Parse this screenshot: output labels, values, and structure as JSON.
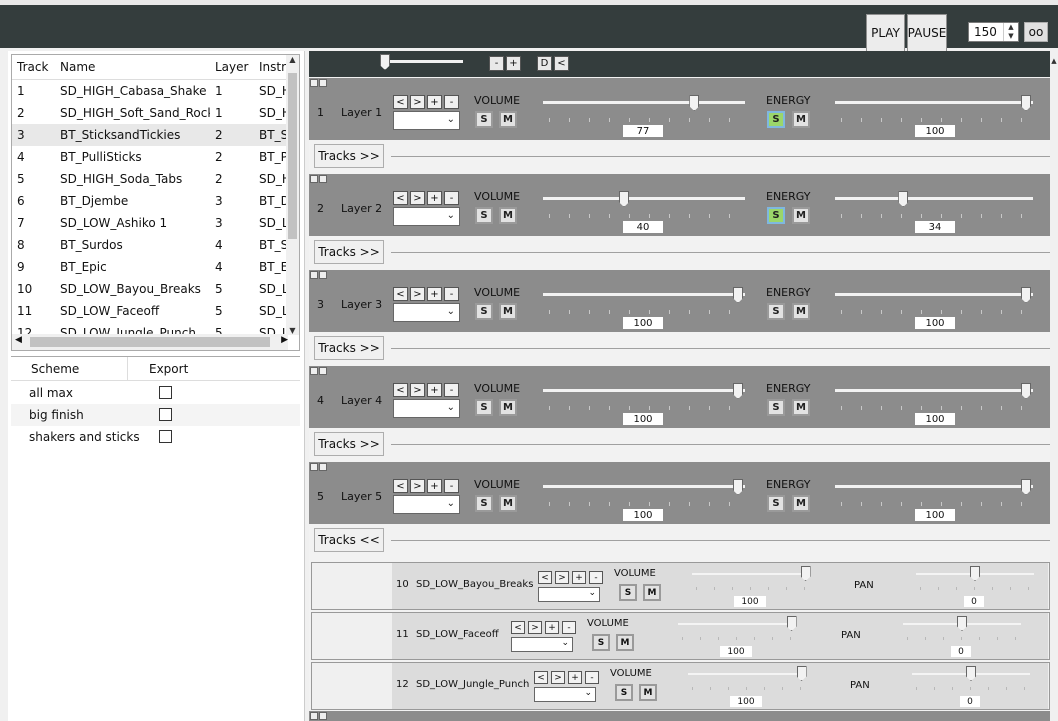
{
  "toolbar": {
    "play_label": "PLAY",
    "pause_label": "PAUSE",
    "tempo_value": "150",
    "oo_label": "oo"
  },
  "tracks": {
    "headers": [
      "Track",
      "Name",
      "Layer",
      "Instru"
    ],
    "rows": [
      {
        "track": "1",
        "name": "SD_HIGH_Cabasa_Shake",
        "layer": "1",
        "instr": "SD_HI"
      },
      {
        "track": "2",
        "name": "SD_HIGH_Soft_Sand_Rocks",
        "layer": "1",
        "instr": "SD_HI"
      },
      {
        "track": "3",
        "name": "BT_SticksandTickies",
        "layer": "2",
        "instr": "BT_St"
      },
      {
        "track": "4",
        "name": "BT_PulliSticks",
        "layer": "2",
        "instr": "BT_Pu"
      },
      {
        "track": "5",
        "name": "SD_HIGH_Soda_Tabs",
        "layer": "2",
        "instr": "SD_HI"
      },
      {
        "track": "6",
        "name": "BT_Djembe",
        "layer": "3",
        "instr": "BT_Dj"
      },
      {
        "track": "7",
        "name": "SD_LOW_Ashiko 1",
        "layer": "3",
        "instr": "SD_LC"
      },
      {
        "track": "8",
        "name": "BT_Surdos",
        "layer": "4",
        "instr": "BT_Su"
      },
      {
        "track": "9",
        "name": "BT_Epic",
        "layer": "4",
        "instr": "BT_Ep"
      },
      {
        "track": "10",
        "name": "SD_LOW_Bayou_Breaks",
        "layer": "5",
        "instr": "SD_LC"
      },
      {
        "track": "11",
        "name": "SD_LOW_Faceoff",
        "layer": "5",
        "instr": "SD_LC"
      },
      {
        "track": "12",
        "name": "SD_LOW_Jungle_Punch",
        "layer": "5",
        "instr": "SD_LC"
      }
    ]
  },
  "schemes": {
    "headers": [
      "Scheme",
      "Export"
    ],
    "rows": [
      {
        "name": "all max",
        "checked": false
      },
      {
        "name": "big finish",
        "checked": false
      },
      {
        "name": "shakers and sticks",
        "checked": false
      }
    ]
  },
  "topcontrols": {
    "minus": "-",
    "plus": "+",
    "d": "D",
    "lt": "<"
  },
  "layer_buttons": {
    "prev": "<",
    "next": ">",
    "add": "+",
    "remove": "-",
    "solo": "S",
    "mute": "M",
    "volume": "VOLUME",
    "energy": "ENERGY",
    "pan": "PAN"
  },
  "layers": [
    {
      "num": "1",
      "name": "Layer 1",
      "volume": "77",
      "energy": "100",
      "solo_on": false,
      "energy_solo_on": true,
      "tracks_label": "Tracks >>"
    },
    {
      "num": "2",
      "name": "Layer 2",
      "volume": "40",
      "energy": "34",
      "solo_on": false,
      "energy_solo_on": true,
      "tracks_label": "Tracks >>"
    },
    {
      "num": "3",
      "name": "Layer 3",
      "volume": "100",
      "energy": "100",
      "solo_on": false,
      "energy_solo_on": false,
      "tracks_label": "Tracks >>"
    },
    {
      "num": "4",
      "name": "Layer 4",
      "volume": "100",
      "energy": "100",
      "solo_on": false,
      "energy_solo_on": false,
      "tracks_label": "Tracks >>"
    },
    {
      "num": "5",
      "name": "Layer 5",
      "volume": "100",
      "energy": "100",
      "solo_on": false,
      "energy_solo_on": false,
      "tracks_label": "Tracks <<"
    }
  ],
  "subtracks": [
    {
      "num": "10",
      "name": "SD_LOW_Bayou_Breaks",
      "volume": "100",
      "pan": "0"
    },
    {
      "num": "11",
      "name": "SD_LOW_Faceoff",
      "volume": "100",
      "pan": "0"
    },
    {
      "num": "12",
      "name": "SD_LOW_Jungle_Punch",
      "volume": "100",
      "pan": "0"
    }
  ],
  "colors": {
    "dark_bar": "#343d3d",
    "layer_bg": "#8c8c8c",
    "solo_active": "#9bd66a"
  }
}
